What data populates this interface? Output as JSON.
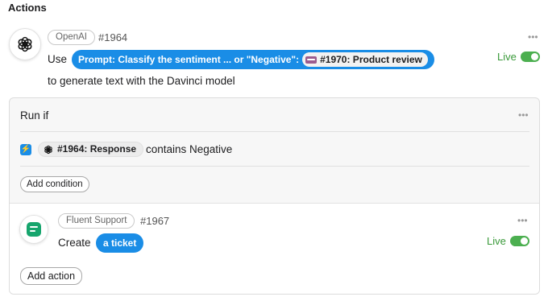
{
  "section": {
    "title": "Actions"
  },
  "action1": {
    "app_tag": "OpenAI",
    "step_id": "#1964",
    "prefix": "Use",
    "prompt_pill": "Prompt: Classify the sentiment ... or \"Negative\":",
    "sub_pill": "#1970: Product review",
    "suffix": "to generate text with the Davinci model",
    "status": "Live",
    "more_label": "•••"
  },
  "run_if": {
    "title": "Run if",
    "more_label": "•••",
    "condition": {
      "field": "#1964: Response",
      "operator_value": "contains Negative"
    },
    "add_condition_label": "Add condition"
  },
  "action2": {
    "app_tag": "Fluent Support",
    "step_id": "#1967",
    "prefix": "Create",
    "object_pill": "a ticket",
    "status": "Live",
    "more_label": "•••"
  },
  "add_action_label": "Add action",
  "colors": {
    "accent_blue": "#1a8de6",
    "live_green": "#4caf50",
    "fluent_green": "#16a56d"
  }
}
